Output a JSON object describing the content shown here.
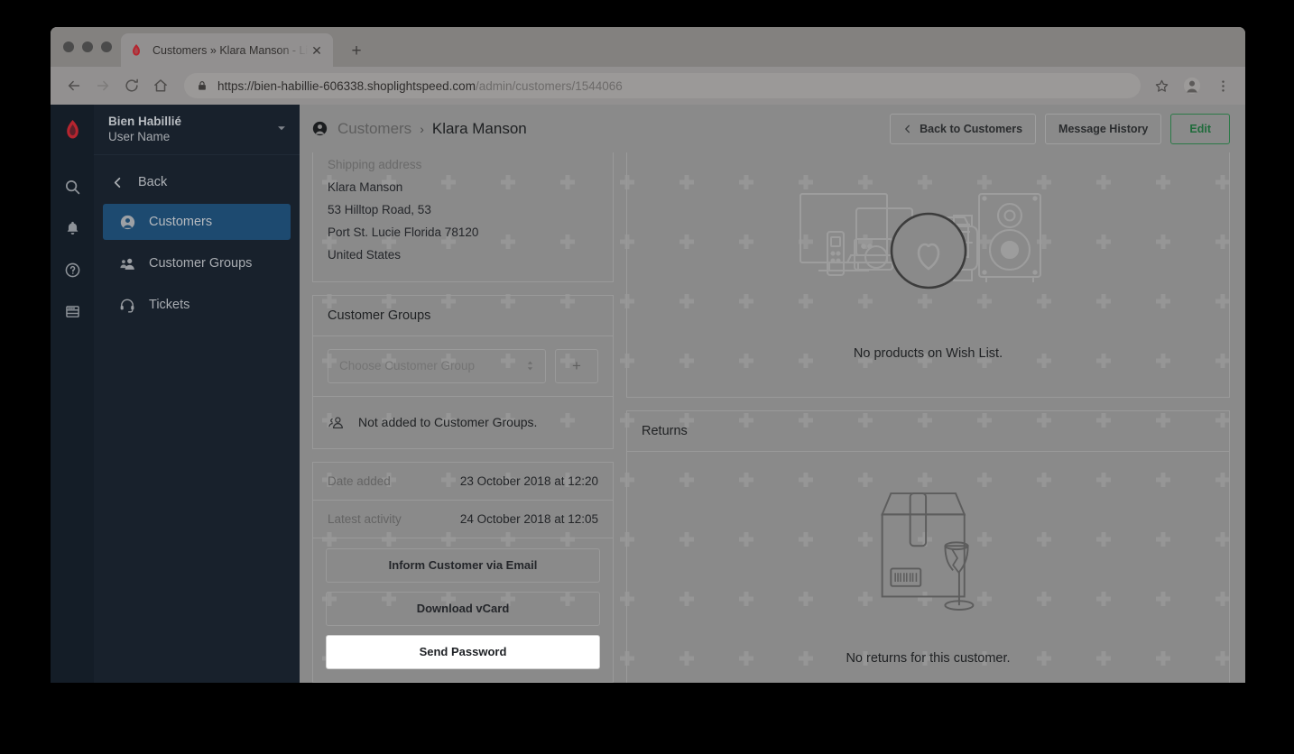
{
  "browser": {
    "tab": {
      "title": "Customers » Klara Manson - Li",
      "favicon": "lightspeed-flame-icon",
      "close_label": "✕"
    },
    "new_tab_label": "+",
    "nav": {
      "back_label": "←",
      "forward_label": "→",
      "reload_label": "⟳",
      "home_label": "⌂"
    },
    "url": {
      "scheme_host": "https://bien-habillie-606338.shoplightspeed.com",
      "path": "/admin/customers/1544066",
      "full": "https://bien-habillie-606338.shoplightspeed.com/admin/customers/1544066"
    },
    "right_icons": [
      "star-icon",
      "profile-avatar-icon",
      "kebab-menu-icon"
    ]
  },
  "rail": {
    "logo": "lightspeed-flame-logo",
    "icons": [
      "search-icon",
      "notifications-bell-icon",
      "help-circle-icon",
      "apps-window-icon"
    ]
  },
  "sidebar": {
    "account": {
      "shop_name": "Bien Habillié",
      "user_name": "User Name",
      "caret": "chevron-down-icon"
    },
    "back_label": "Back",
    "items": [
      {
        "label": "Customers",
        "icon": "user-circle-icon",
        "active": true
      },
      {
        "label": "Customer Groups",
        "icon": "users-group-icon",
        "active": false
      },
      {
        "label": "Tickets",
        "icon": "headset-icon",
        "active": false
      }
    ]
  },
  "header": {
    "breadcrumb_icon": "user-circle-icon",
    "breadcrumb_parent": "Customers",
    "breadcrumb_separator": "›",
    "breadcrumb_current": "Klara Manson",
    "buttons": [
      {
        "label": "Back to Customers",
        "icon": "chevron-left-icon",
        "style": "default"
      },
      {
        "label": "Message History",
        "icon": "",
        "style": "default"
      },
      {
        "label": "Edit",
        "icon": "",
        "style": "primary"
      }
    ]
  },
  "left_column": {
    "address": {
      "label": "Shipping address",
      "lines": [
        "Klara Manson",
        "53 Hilltop Road, 53",
        "Port St. Lucie Florida 78120",
        "United States"
      ]
    },
    "customer_groups": {
      "title": "Customer Groups",
      "select_placeholder": "Choose Customer Group",
      "add_button_label": "+",
      "empty_icon": "users-group-icon",
      "empty_text": "Not added to Customer Groups."
    },
    "meta": [
      {
        "key": "Date added",
        "value": "23 October 2018 at 12:20"
      },
      {
        "key": "Latest activity",
        "value": "24 October 2018 at 12:05"
      }
    ],
    "actions": [
      {
        "label": "Inform Customer via Email",
        "highlighted": false
      },
      {
        "label": "Download vCard",
        "highlighted": false
      },
      {
        "label": "Send Password",
        "highlighted": true
      }
    ]
  },
  "right_column": {
    "wishlist": {
      "illustration": "electronics-with-heart-magnifier-illustration",
      "empty_text": "No products on Wish List."
    },
    "returns": {
      "title": "Returns",
      "illustration": "box-with-broken-glass-illustration",
      "empty_text": "No returns for this customer."
    }
  },
  "colors": {
    "sidebar_bg": "#18212c",
    "rail_bg": "#141d27",
    "active_nav": "#1d4a70",
    "brand_red": "#b5252f",
    "edit_green": "#1f6b3b",
    "overlay_gray": "#8a8a8a"
  }
}
